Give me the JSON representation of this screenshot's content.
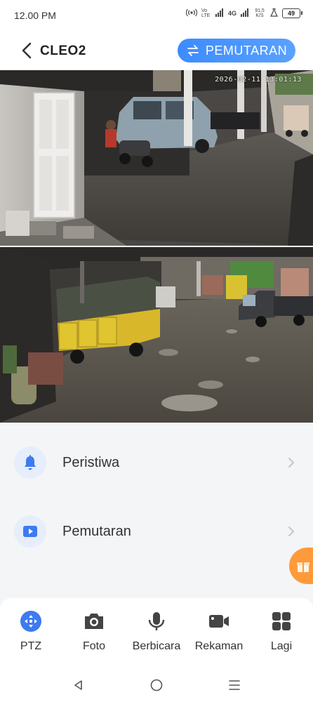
{
  "status_bar": {
    "time": "12.00 PM",
    "volte": "Vo LTE",
    "network": "4G",
    "speed": "91,5 K/S",
    "battery": "49"
  },
  "header": {
    "title": "CLEO2",
    "playback_button": "PEMUTARAN"
  },
  "feeds": [
    {
      "name": "camera-1",
      "timestamp": "2026-02-11 13:01:13"
    },
    {
      "name": "camera-2"
    }
  ],
  "menu": [
    {
      "label": "Peristiwa",
      "icon": "bell-icon"
    },
    {
      "label": "Pemutaran",
      "icon": "play-icon"
    }
  ],
  "toolbar": [
    {
      "label": "PTZ",
      "icon": "ptz-icon"
    },
    {
      "label": "Foto",
      "icon": "camera-icon"
    },
    {
      "label": "Berbicara",
      "icon": "microphone-icon"
    },
    {
      "label": "Rekaman",
      "icon": "video-record-icon"
    },
    {
      "label": "Lagi",
      "icon": "grid-icon"
    }
  ],
  "colors": {
    "accent": "#3d8bff",
    "gift": "#ff9a3a"
  }
}
